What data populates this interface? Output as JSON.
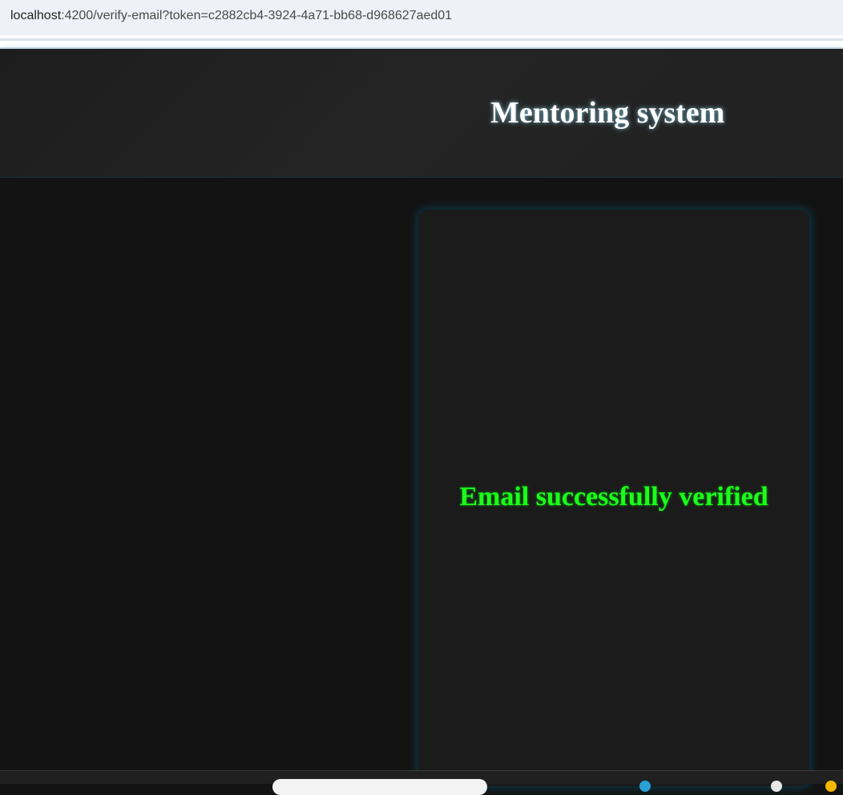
{
  "browser": {
    "url_host": "localhost",
    "url_rest": ":4200/verify-email?token=c2882cb4-3924-4a71-bb68-d968627aed01"
  },
  "header": {
    "title": "Mentoring system"
  },
  "verification": {
    "message": "Email successfully verified",
    "status_color": "#1bff1b"
  },
  "taskbar": {
    "search_icon": "search-icon",
    "app_icons": [
      "edge-icon",
      "weather-icon",
      "notification-icon"
    ]
  }
}
